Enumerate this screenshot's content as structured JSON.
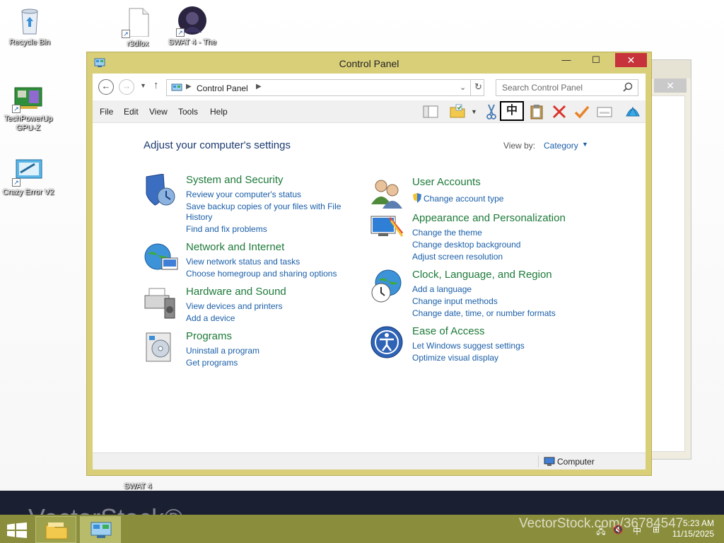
{
  "desktop": {
    "icons": [
      {
        "label": "Recycle Bin"
      },
      {
        "label": "r3dfox"
      },
      {
        "label": "SWAT 4 - The"
      },
      {
        "label": "TechPowerUp GPU-Z"
      },
      {
        "label": "Crazy Error V2"
      },
      {
        "label": "SWAT 4"
      }
    ]
  },
  "window": {
    "title": "Control Panel",
    "address": {
      "crumb": "Control Panel"
    },
    "search": {
      "placeholder": "Search Control Panel"
    },
    "menu": [
      "File",
      "Edit",
      "View",
      "Tools",
      "Help"
    ],
    "toolbar_box_glyph": "中",
    "heading": "Adjust your computer's settings",
    "view_by": {
      "label": "View by:",
      "value": "Category"
    },
    "categories_left": [
      {
        "title": "System and Security",
        "icon": "shield-icon",
        "links": [
          "Review your computer's status",
          "Save backup copies of your files with File",
          "History",
          "Find and fix problems"
        ]
      },
      {
        "title": "Network and Internet",
        "icon": "globe-network-icon",
        "links": [
          "View network status and tasks",
          "Choose homegroup and sharing options"
        ]
      },
      {
        "title": "Hardware and Sound",
        "icon": "printer-speaker-icon",
        "links": [
          "View devices and printers",
          "Add a device"
        ]
      },
      {
        "title": "Programs",
        "icon": "programs-icon",
        "links": [
          "Uninstall a program",
          "Get programs"
        ]
      }
    ],
    "categories_right": [
      {
        "title": "User Accounts",
        "icon": "users-icon",
        "links": [
          "Change account type"
        ]
      },
      {
        "title": "Appearance and Personalization",
        "icon": "display-icon",
        "links": [
          "Change the theme",
          "Change desktop background",
          "Adjust screen resolution"
        ]
      },
      {
        "title": "Clock, Language, and Region",
        "icon": "globe-clock-icon",
        "links": [
          "Add a language",
          "Change input methods",
          "Change date, time, or number formats"
        ]
      },
      {
        "title": "Ease of Access",
        "icon": "ease-of-access-icon",
        "links": [
          "Let Windows suggest settings",
          "Optimize visual display"
        ]
      }
    ],
    "status": {
      "location": "Computer"
    }
  },
  "taskbar": {
    "watermark_logo": "VectorStock®",
    "watermark_url": "VectorStock.com/36784547",
    "time": "5:23 AM",
    "date": "11/15/2025"
  },
  "colors": {
    "window_frame": "#d9cf79",
    "close_button": "#c7333a",
    "category_title": "#1e7a3a",
    "link": "#1a5ea8",
    "taskbar": "#8a8e3c"
  }
}
